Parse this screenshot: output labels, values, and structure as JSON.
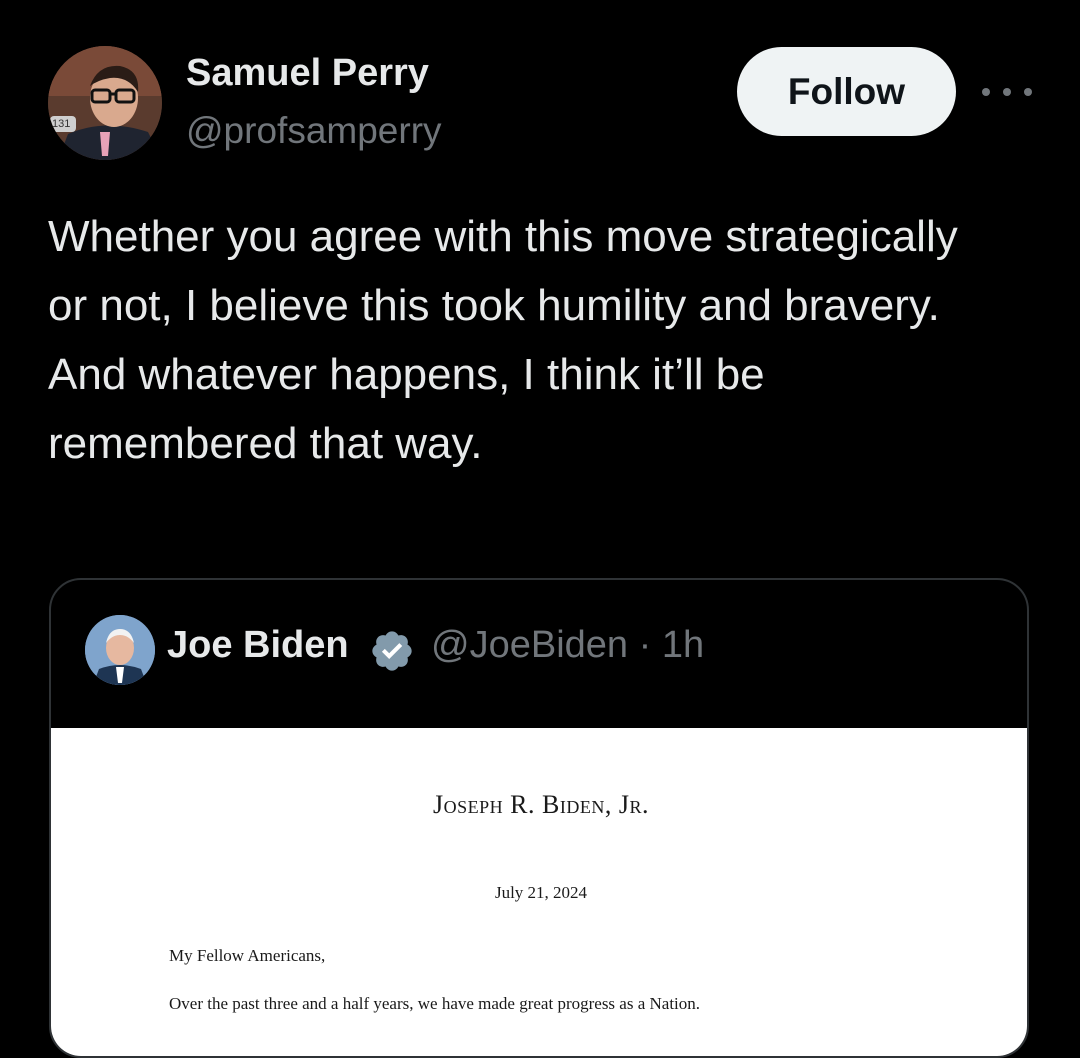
{
  "author": {
    "name": "Samuel Perry",
    "handle": "@profsamperry",
    "avatar_badge": "131"
  },
  "actions": {
    "follow_label": "Follow"
  },
  "tweet": {
    "text": "Whether you agree with this move strategically or not, I believe this took humility and bravery. And whatever happens, I think it’ll be remembered that way."
  },
  "quoted": {
    "name": "Joe Biden",
    "handle": "@JoeBiden",
    "separator": "·",
    "time": "1h",
    "verified_icon": "verified-badge-icon",
    "letter": {
      "heading": "Joseph R. Biden, Jr.",
      "date": "July 21, 2024",
      "salutation": "My Fellow Americans,",
      "first_line": "Over the past three and a half years, we have made great progress as a Nation."
    }
  },
  "colors": {
    "background": "#000000",
    "text_primary": "#e7e9ea",
    "text_secondary": "#71767b",
    "button_bg": "#eff3f4",
    "verified_fill": "#829aab",
    "border": "#2f3336"
  }
}
